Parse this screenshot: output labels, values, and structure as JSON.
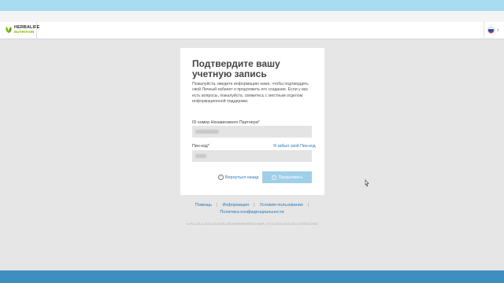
{
  "header": {
    "logo_line1": "HERBALIFE",
    "logo_line2": "NUTRITION",
    "language_icon": "russian-flag-icon",
    "chevron_icon": "chevron-right-icon"
  },
  "colors": {
    "top_band": "#a8dcf0",
    "bottom_band": "#3e8fc0",
    "link": "#2a7ab8",
    "button": "#9fcfe9"
  },
  "card": {
    "title": "Подтвердите вашу учетную запись",
    "description": "Пожалуйста, введите информацию ниже, чтобы подтвердить свой Личный кабинет и продолжить его создание. Если у вас есть вопросы, пожалуйста, свяжитесь с местным отделом информационной поддержки.",
    "id_label": "ID номер Независимого Партнера*",
    "pin_label": "Пин-код*",
    "forgot_pin": "Я забыл свой Пин-код",
    "back_label": "Вернуться назад",
    "continue_label": "Продолжить"
  },
  "footer": {
    "links_row1": [
      "Помощь",
      "Информация",
      "Условия пользования"
    ],
    "links_row2": [
      "Политика конфиденциальности"
    ],
    "build_info": "ru-RU | 20.11.2016 15:43:35 | ZELAWWWSWEB04 | MyHL | 20.11.2016 15:43:35 | 1.0.0000.22445"
  }
}
